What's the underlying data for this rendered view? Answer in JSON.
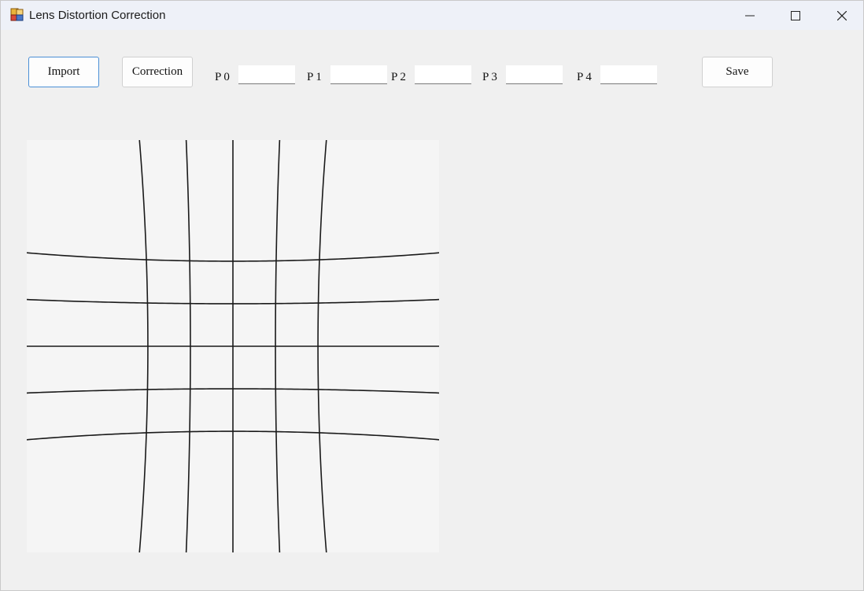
{
  "window": {
    "title": "Lens Distortion Correction",
    "controls": {
      "minimize": "minimize-icon",
      "maximize": "maximize-icon",
      "close": "close-icon"
    }
  },
  "toolbar": {
    "import_label": "Import",
    "correction_label": "Correction",
    "save_label": "Save"
  },
  "params": [
    {
      "label": "P0",
      "value": ""
    },
    {
      "label": "P1",
      "value": ""
    },
    {
      "label": "P2",
      "value": ""
    },
    {
      "label": "P3",
      "value": ""
    },
    {
      "label": "P4",
      "value": ""
    }
  ],
  "image": {
    "description_icon": "distorted-grid-image",
    "grid_divisions": 6,
    "barrel_coefficient": 0.1,
    "line_color": "#1a1a1a"
  },
  "colors": {
    "accent": "#4a8fd6",
    "background": "#f0f0f0"
  }
}
